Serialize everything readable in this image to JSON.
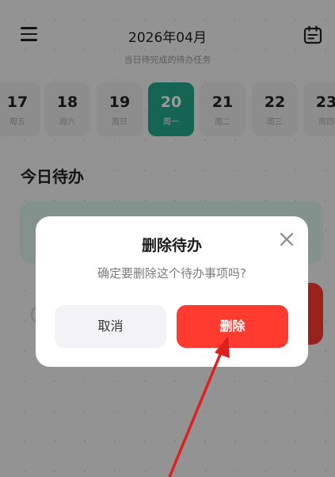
{
  "header": {
    "title": "2026年04月",
    "subtitle": "当日待完成的待办任务"
  },
  "days": [
    {
      "num": "17",
      "weekday": "周五"
    },
    {
      "num": "18",
      "weekday": "周六"
    },
    {
      "num": "19",
      "weekday": "周日"
    },
    {
      "num": "20",
      "weekday": "周一",
      "selected": true
    },
    {
      "num": "21",
      "weekday": "周二"
    },
    {
      "num": "22",
      "weekday": "周三"
    },
    {
      "num": "23",
      "weekday": "周四"
    }
  ],
  "section": {
    "title": "今日待办"
  },
  "dialog": {
    "title": "删除待办",
    "message": "确定要删除这个待办事项吗?",
    "cancel_label": "取消",
    "delete_label": "删除"
  },
  "colors": {
    "accent": "#26a98d",
    "danger": "#ff3b30",
    "annotation_arrow": "#e0201e"
  },
  "icons": {
    "menu": "hamburger-menu-icon",
    "calendar": "calendar-icon",
    "close": "close-icon"
  }
}
